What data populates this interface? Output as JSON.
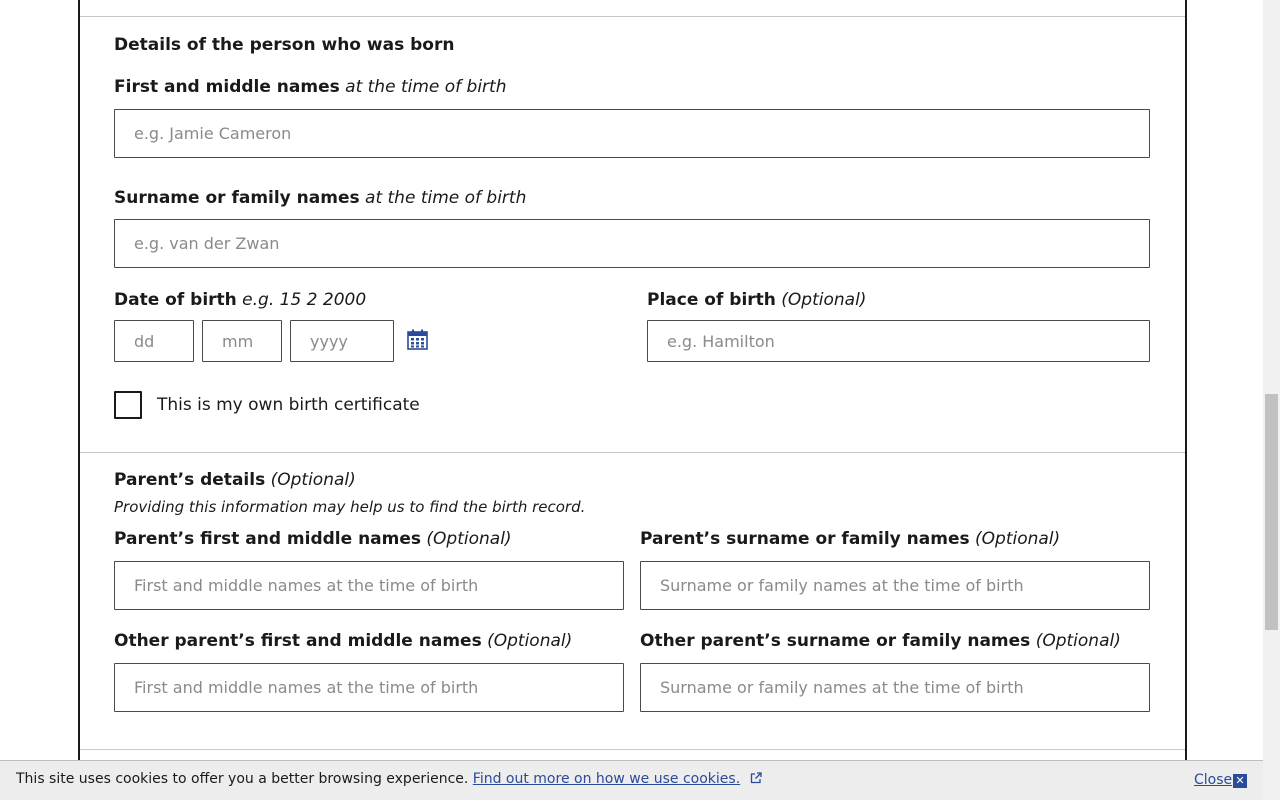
{
  "born_section": {
    "title": "Details of the person who was born",
    "first_names": {
      "label": "First and middle names",
      "hint": "at the time of birth",
      "placeholder": "e.g. Jamie Cameron"
    },
    "surname": {
      "label": "Surname or family names",
      "hint": "at the time of birth",
      "placeholder": "e.g. van der Zwan"
    },
    "dob": {
      "label": "Date of birth",
      "hint": "e.g. 15 2 2000",
      "day_placeholder": "dd",
      "month_placeholder": "mm",
      "year_placeholder": "yyyy",
      "icon": "calendar-icon"
    },
    "place": {
      "label": "Place of birth",
      "hint": "(Optional)",
      "placeholder": "e.g. Hamilton"
    },
    "own_cert_label": "This is my own birth certificate"
  },
  "parents_section": {
    "title": "Parent’s details",
    "title_hint": "(Optional)",
    "helper": "Providing this information may help us to find the birth record.",
    "parent_first": {
      "label": "Parent’s first and middle names",
      "hint": "(Optional)",
      "placeholder": "First and middle names at the time of birth"
    },
    "parent_surname": {
      "label": "Parent’s surname or family names",
      "hint": "(Optional)",
      "placeholder": "Surname or family names at the time of birth"
    },
    "other_first": {
      "label": "Other parent’s first and middle names",
      "hint": "(Optional)",
      "placeholder": "First and middle names at the time of birth"
    },
    "other_surname": {
      "label": "Other parent’s surname or family names",
      "hint": "(Optional)",
      "placeholder": "Surname or family names at the time of birth"
    }
  },
  "cookie_banner": {
    "text": "This site uses cookies to offer you a better browsing experience.",
    "link": "Find out more on how we use cookies.",
    "close": "Close"
  },
  "colors": {
    "link": "#2a4a9a",
    "border": "#4a4a4a"
  }
}
